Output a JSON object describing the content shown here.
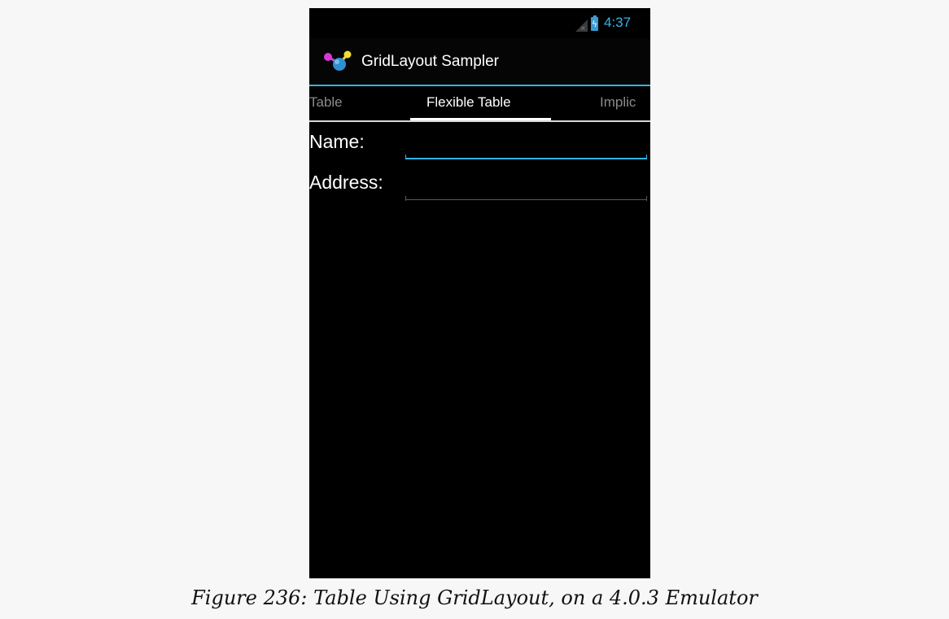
{
  "status_bar": {
    "time": "4:37",
    "icons": [
      "signal-icon",
      "battery-charging-icon"
    ],
    "accent_color": "#33b5e5"
  },
  "action_bar": {
    "title": "GridLayout Sampler",
    "icon": "molecule-app-icon"
  },
  "tabs": [
    {
      "label": "Table",
      "selected": false
    },
    {
      "label": "Flexible Table",
      "selected": true
    },
    {
      "label": "Implic",
      "selected": false
    }
  ],
  "form": {
    "name_label": "Name:",
    "name_value": "",
    "address_label": "Address:",
    "address_value": ""
  },
  "caption": "Figure 236: Table Using GridLayout, on a 4.0.3 Emulator"
}
